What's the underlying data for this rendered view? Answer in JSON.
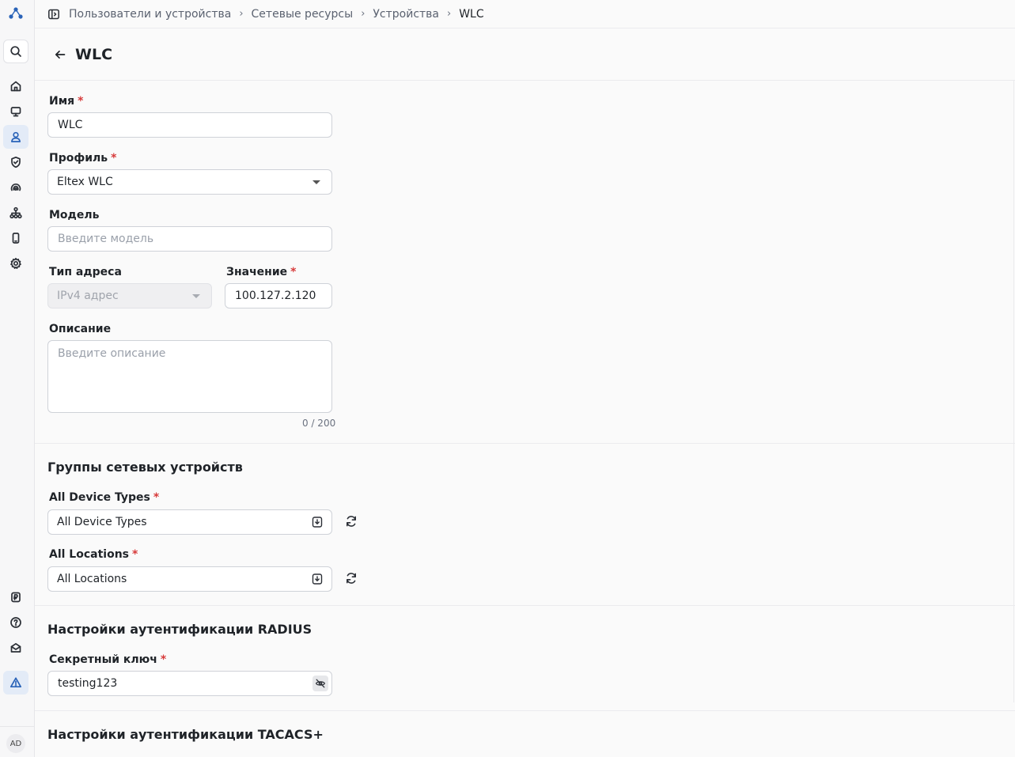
{
  "breadcrumb": {
    "items": [
      "Пользователи и устройства",
      "Сетевые ресурсы",
      "Устройства"
    ],
    "current": "WLC"
  },
  "page": {
    "title": "WLC"
  },
  "form": {
    "name": {
      "label": "Имя",
      "value": "WLC"
    },
    "profile": {
      "label": "Профиль",
      "value": "Eltex WLC"
    },
    "model": {
      "label": "Модель",
      "placeholder": "Введите модель"
    },
    "address_type": {
      "label": "Тип адреса",
      "value": "IPv4 адрес"
    },
    "address_value": {
      "label": "Значение",
      "value": "100.127.2.120"
    },
    "description": {
      "label": "Описание",
      "placeholder": "Введите описание",
      "counter": "0 / 200"
    }
  },
  "groups": {
    "title": "Группы сетевых устройств",
    "device_types": {
      "label": "All Device Types",
      "value": "All Device Types"
    },
    "locations": {
      "label": "All Locations",
      "value": "All Locations"
    }
  },
  "radius": {
    "title": "Настройки аутентификации RADIUS",
    "secret": {
      "label": "Секретный ключ",
      "value": "testing123"
    }
  },
  "tacacs": {
    "title": "Настройки аутентификации TACACS+"
  },
  "user": {
    "initials": "AD"
  },
  "required_mark": "*",
  "colors": {
    "accent": "#2a63b8",
    "required": "#d73a3a"
  }
}
